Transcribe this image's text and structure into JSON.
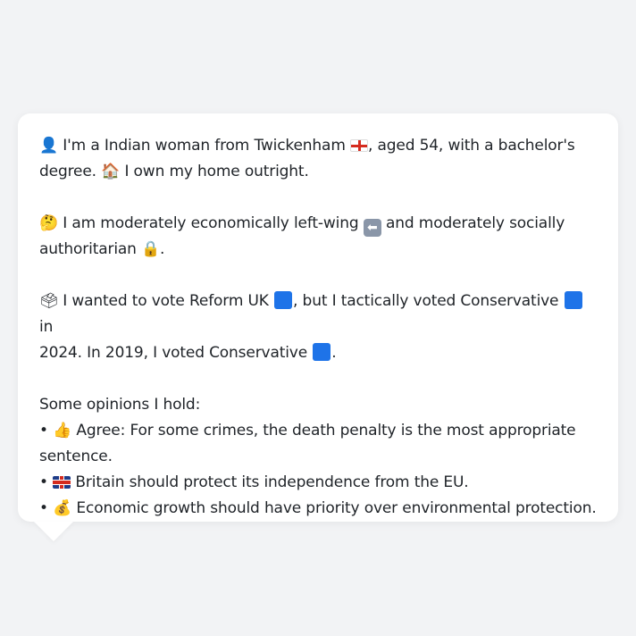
{
  "profile": {
    "intro": {
      "person_icon": "👤",
      "text_a": "I'm a Indian woman from Twickenham ",
      "flag_icon": "england-flag-icon",
      "text_b": ", aged 54, with a bachelor's",
      "text_c": "degree. ",
      "house_icon": "🏠",
      "text_d": " I own my home outright."
    },
    "ideology": {
      "thinking_icon": "🤔",
      "text_a": " I am moderately economically left-wing ",
      "arrow_icon": "⬅",
      "text_b": " and moderately socially",
      "text_c": "authoritarian ",
      "lock_icon": "🔒",
      "text_d": "."
    },
    "vote": {
      "ballot_icon": "🗳",
      "text_a": " I wanted to vote Reform UK ",
      "text_b": ", but I tactically voted Conservative ",
      "text_c": " in",
      "text_d": "2024. In 2019, I voted Conservative ",
      "text_e": ".",
      "party_color": "#1e73e8"
    },
    "opinions": {
      "heading": "Some opinions I hold:",
      "bullet": "•",
      "items": [
        {
          "icon": "👍",
          "line1": " Agree: For some crimes, the death penalty is the most appropriate",
          "line2": "sentence."
        },
        {
          "icon": "uk-flag-icon",
          "line1": " Britain should protect its independence from the EU."
        },
        {
          "icon": "💰",
          "line1": " Economic growth should have priority over environmental protection."
        }
      ]
    }
  }
}
